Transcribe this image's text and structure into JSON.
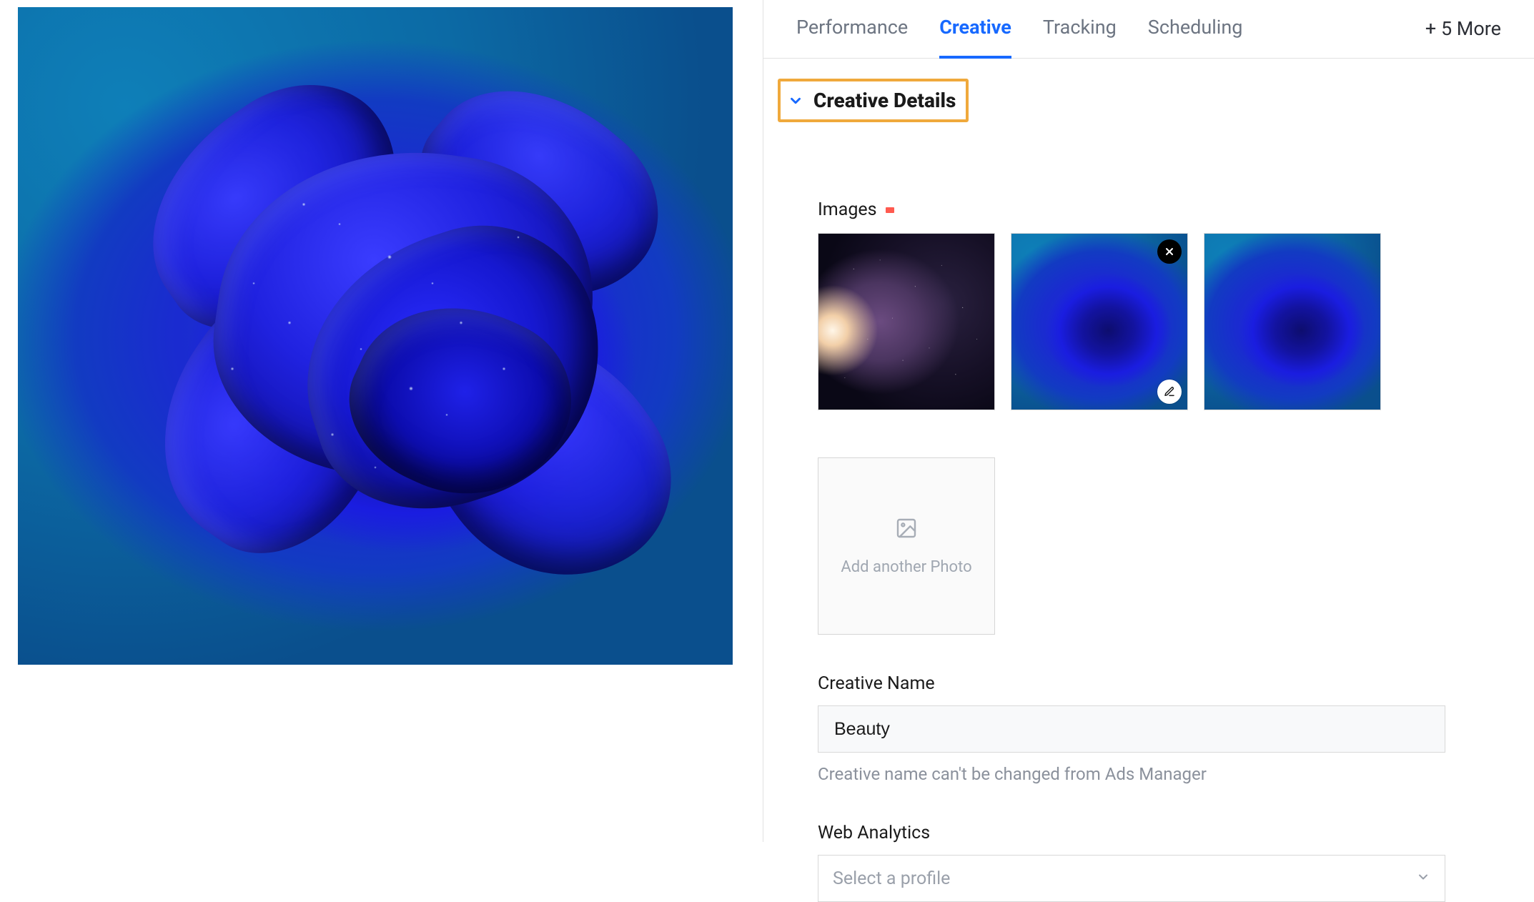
{
  "tabs": {
    "items": [
      "Performance",
      "Creative",
      "Tracking",
      "Scheduling"
    ],
    "active_index": 1,
    "more_label": "+ 5 More"
  },
  "accordion": {
    "title": "Creative Details"
  },
  "images_section": {
    "label": "Images",
    "thumbnails": [
      {
        "kind": "nebula",
        "alt": "nebula-image"
      },
      {
        "kind": "rose",
        "alt": "blue-rose-image",
        "has_close": true,
        "has_edit": true
      },
      {
        "kind": "rose",
        "alt": "blue-rose-image"
      }
    ],
    "add_tile_label": "Add another Photo"
  },
  "creative_name": {
    "label": "Creative Name",
    "value": "Beauty",
    "hint": "Creative name can't be changed from Ads Manager"
  },
  "web_analytics": {
    "label": "Web Analytics",
    "placeholder": "Select a profile"
  }
}
